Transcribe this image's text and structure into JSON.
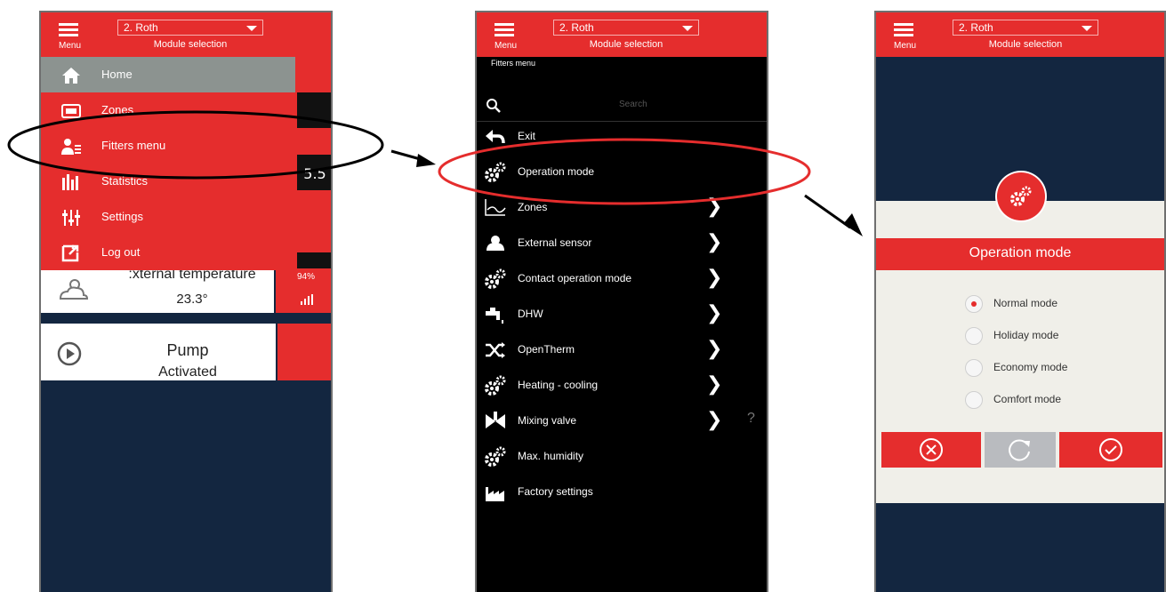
{
  "header": {
    "menu_label": "Menu",
    "module_value": "2. Roth",
    "module_label": "Module selection"
  },
  "panel1": {
    "drawer_items": [
      {
        "label": "Home",
        "icon": "home-icon"
      },
      {
        "label": "Zones",
        "icon": "zones-icon"
      },
      {
        "label": "Fitters menu",
        "icon": "fitter-icon"
      },
      {
        "label": "Statistics",
        "icon": "statistics-icon"
      },
      {
        "label": "Settings",
        "icon": "settings-icon"
      },
      {
        "label": "Log out",
        "icon": "logout-icon"
      }
    ],
    "background_digits": "5.5",
    "ext_title": ":xternal temperature",
    "ext_value": "23.3°",
    "battery": "94%",
    "pump_title": "Pump",
    "pump_value": "Activated"
  },
  "panel2": {
    "title": "Fitters menu",
    "search_placeholder": "Search",
    "items": [
      {
        "label": "Exit",
        "icon": "back-arrow-icon",
        "chevron": false
      },
      {
        "label": "Operation mode",
        "icon": "gears-icon",
        "chevron": false
      },
      {
        "label": "Zones",
        "icon": "zones-chart-icon",
        "chevron": true
      },
      {
        "label": "External sensor",
        "icon": "external-sensor-icon",
        "chevron": true
      },
      {
        "label": "Contact operation mode",
        "icon": "gears-icon",
        "chevron": true
      },
      {
        "label": "DHW",
        "icon": "tap-icon",
        "chevron": true
      },
      {
        "label": "OpenTherm",
        "icon": "shuffle-icon",
        "chevron": true
      },
      {
        "label": "Heating - cooling",
        "icon": "gears-icon",
        "chevron": true
      },
      {
        "label": "Mixing valve",
        "icon": "valve-icon",
        "chevron": true
      },
      {
        "label": "Max. humidity",
        "icon": "gears-icon",
        "chevron": false
      },
      {
        "label": "Factory settings",
        "icon": "factory-icon",
        "chevron": false
      }
    ],
    "help": "?"
  },
  "panel3": {
    "title": "Operation mode",
    "options": [
      {
        "label": "Normal mode",
        "selected": true
      },
      {
        "label": "Holiday mode",
        "selected": false
      },
      {
        "label": "Economy mode",
        "selected": false
      },
      {
        "label": "Comfort mode",
        "selected": false
      }
    ]
  },
  "colors": {
    "accent": "#e52d2d",
    "dark": "#132640",
    "black": "#000000",
    "selected_item": "#8c9390"
  }
}
